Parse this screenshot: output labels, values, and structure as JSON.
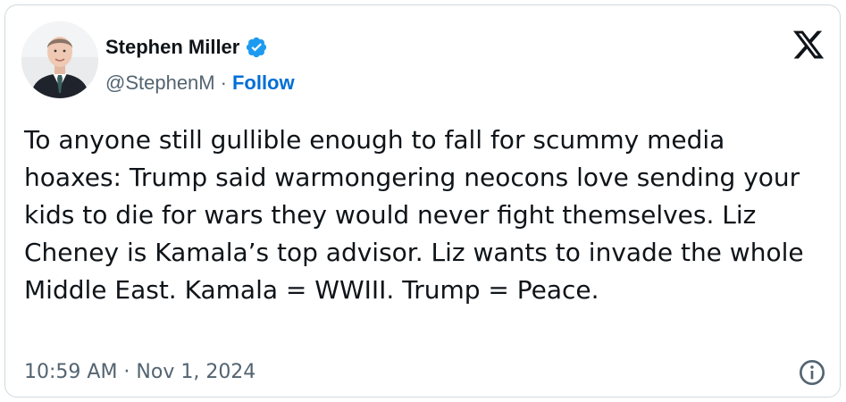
{
  "author": {
    "name": "Stephen Miller",
    "handle": "@StephenM",
    "separator": "·",
    "follow_label": "Follow",
    "verified_icon": "verified-badge-icon",
    "avatar_icon": "profile-photo"
  },
  "tweet": {
    "text": "To anyone still gullible enough to fall for scummy media hoaxes: Trump said warmongering neocons love sending your kids to die for wars they would never fight themselves. Liz Cheney is Kamala’s top advisor. Liz wants to invade the whole Middle East. Kamala = WWIII. Trump = Peace.",
    "timestamp": "10:59 AM · Nov 1, 2024"
  },
  "icons": {
    "brand": "x-logo-icon",
    "info": "info-icon"
  },
  "colors": {
    "text": "#0f1419",
    "secondary": "#536471",
    "link": "#006fd6",
    "verified": "#1d9bf0",
    "border": "#cfd9de"
  }
}
